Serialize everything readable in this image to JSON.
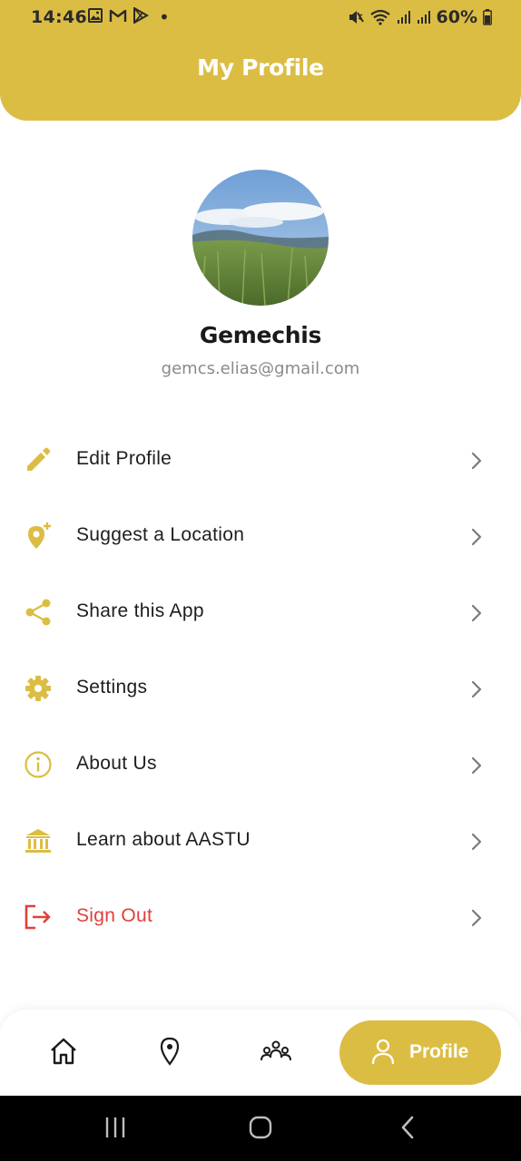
{
  "status_bar": {
    "time": "14:46",
    "battery": "60%"
  },
  "header": {
    "title": "My Profile"
  },
  "profile": {
    "name": "Gemechis",
    "email": "gemcs.elias@gmail.com"
  },
  "menu": {
    "items": [
      {
        "label": "Edit Profile",
        "icon": "pencil-icon"
      },
      {
        "label": "Suggest a Location",
        "icon": "add-location-icon"
      },
      {
        "label": "Share this App",
        "icon": "share-icon"
      },
      {
        "label": "Settings",
        "icon": "gear-icon"
      },
      {
        "label": "About Us",
        "icon": "info-icon"
      },
      {
        "label": "Learn about AASTU",
        "icon": "institution-icon"
      },
      {
        "label": "Sign Out",
        "icon": "logout-icon"
      }
    ]
  },
  "bottom_nav": {
    "items": [
      {
        "icon": "home-icon"
      },
      {
        "icon": "map-pin-icon"
      },
      {
        "icon": "community-icon"
      },
      {
        "icon": "person-icon",
        "label": "Profile",
        "active": true
      }
    ]
  },
  "colors": {
    "accent": "#dcbd44",
    "danger": "#e0403b",
    "text": "#1e1e1e",
    "muted": "#8a8a8a"
  }
}
